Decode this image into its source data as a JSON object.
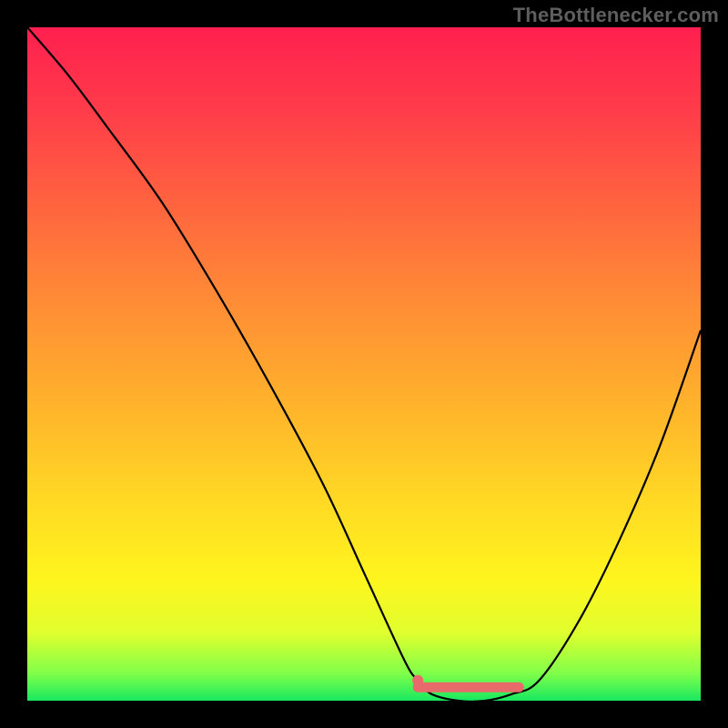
{
  "attribution": "TheBottlenecker.com",
  "colors": {
    "background": "#000000",
    "top_gradient": "#ff1f4f",
    "mid_gradient": "#ffd824",
    "bottom_gradient": "#18e860",
    "curve": "#000000",
    "highlight": "#e96a6a"
  },
  "chart_data": {
    "type": "line",
    "title": "",
    "xlabel": "",
    "ylabel": "",
    "xlim": [
      0,
      100
    ],
    "ylim": [
      0,
      100
    ],
    "series": [
      {
        "name": "bottleneck-curve",
        "x": [
          0,
          6,
          12,
          20,
          28,
          36,
          44,
          50,
          56,
          58,
          60,
          64,
          68,
          72,
          76,
          82,
          88,
          94,
          100
        ],
        "values": [
          100,
          93,
          85,
          74,
          61,
          47,
          32,
          19,
          6,
          3,
          1,
          0,
          0,
          1,
          3,
          12,
          24,
          38,
          55
        ]
      }
    ],
    "highlight_range": {
      "x_start": 58,
      "x_end": 73,
      "y": 2
    },
    "highlight_point": {
      "x": 58,
      "y": 3
    },
    "grid": false,
    "legend": false
  }
}
